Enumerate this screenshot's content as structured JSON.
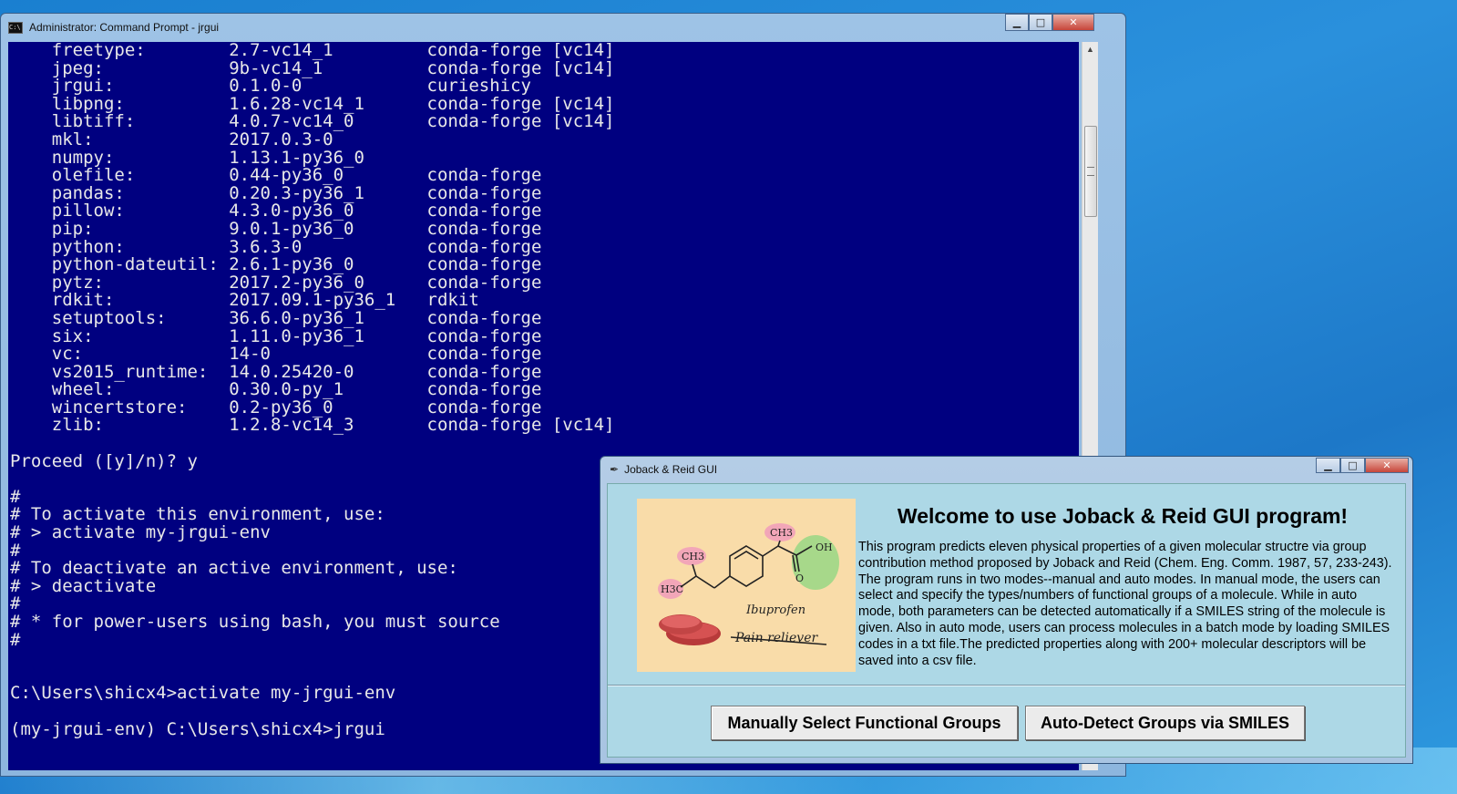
{
  "cmd": {
    "title": "Administrator: Command Prompt - jrgui",
    "icon_label": "C:\\",
    "packages": [
      {
        "name": "freetype:",
        "version": "2.7-vc14_1",
        "channel": "conda-forge [vc14]"
      },
      {
        "name": "jpeg:",
        "version": "9b-vc14_1",
        "channel": "conda-forge [vc14]"
      },
      {
        "name": "jrgui:",
        "version": "0.1.0-0",
        "channel": "curieshicy"
      },
      {
        "name": "libpng:",
        "version": "1.6.28-vc14_1",
        "channel": "conda-forge [vc14]"
      },
      {
        "name": "libtiff:",
        "version": "4.0.7-vc14_0",
        "channel": "conda-forge [vc14]"
      },
      {
        "name": "mkl:",
        "version": "2017.0.3-0",
        "channel": ""
      },
      {
        "name": "numpy:",
        "version": "1.13.1-py36_0",
        "channel": ""
      },
      {
        "name": "olefile:",
        "version": "0.44-py36_0",
        "channel": "conda-forge"
      },
      {
        "name": "pandas:",
        "version": "0.20.3-py36_1",
        "channel": "conda-forge"
      },
      {
        "name": "pillow:",
        "version": "4.3.0-py36_0",
        "channel": "conda-forge"
      },
      {
        "name": "pip:",
        "version": "9.0.1-py36_0",
        "channel": "conda-forge"
      },
      {
        "name": "python:",
        "version": "3.6.3-0",
        "channel": "conda-forge"
      },
      {
        "name": "python-dateutil:",
        "version": "2.6.1-py36_0",
        "channel": "conda-forge"
      },
      {
        "name": "pytz:",
        "version": "2017.2-py36_0",
        "channel": "conda-forge"
      },
      {
        "name": "rdkit:",
        "version": "2017.09.1-py36_1",
        "channel": "rdkit"
      },
      {
        "name": "setuptools:",
        "version": "36.6.0-py36_1",
        "channel": "conda-forge"
      },
      {
        "name": "six:",
        "version": "1.11.0-py36_1",
        "channel": "conda-forge"
      },
      {
        "name": "vc:",
        "version": "14-0",
        "channel": "conda-forge"
      },
      {
        "name": "vs2015_runtime:",
        "version": "14.0.25420-0",
        "channel": "conda-forge"
      },
      {
        "name": "wheel:",
        "version": "0.30.0-py_1",
        "channel": "conda-forge"
      },
      {
        "name": "wincertstore:",
        "version": "0.2-py36_0",
        "channel": "conda-forge"
      },
      {
        "name": "zlib:",
        "version": "1.2.8-vc14_3",
        "channel": "conda-forge [vc14]"
      }
    ],
    "after_lines": [
      "",
      "Proceed ([y]/n)? y",
      "",
      "#",
      "# To activate this environment, use:",
      "# > activate my-jrgui-env",
      "#",
      "# To deactivate an active environment, use:",
      "# > deactivate",
      "#",
      "# * for power-users using bash, you must source",
      "#",
      "",
      "",
      "C:\\Users\\shicx4>activate my-jrgui-env",
      "",
      "(my-jrgui-env) C:\\Users\\shicx4>jrgui"
    ]
  },
  "gui": {
    "title": "Joback & Reid GUI",
    "welcome": "Welcome to use Joback & Reid GUI program!",
    "description": "This program predicts eleven physical properties of a given molecular structre via group contribution method proposed by Joback and Reid (Chem. Eng. Comm. 1987, 57, 233-243). The program runs in two modes--manual and auto modes. In manual mode, the users can select and specify the types/numbers of functional groups of a molecule. While in auto mode, both parameters can be detected automatically if a SMILES string of the molecule is given. Also in auto mode, users can process molecules in a batch mode by loading SMILES codes in a txt file.The predicted properties along with 200+ molecular descriptors will be saved into a csv file.",
    "logo": {
      "label_ch3_top": "CH3",
      "label_ch3_left": "CH3",
      "label_h3c": "H3C",
      "label_oh": "OH",
      "label_o": "O",
      "drug_name": "Ibuprofen",
      "drug_use": "Pain reliever"
    },
    "buttons": {
      "manual": "Manually Select Functional Groups",
      "auto": "Auto-Detect Groups via SMILES"
    }
  },
  "icons": {
    "minimize": "minimize-icon",
    "maximize": "maximize-icon",
    "close": "close-icon",
    "feather": "feather-icon"
  },
  "colors": {
    "console_bg": "#000080",
    "console_text": "#e8e8e8",
    "gui_bg": "#add8e6",
    "logo_bg": "#f9dca9"
  }
}
